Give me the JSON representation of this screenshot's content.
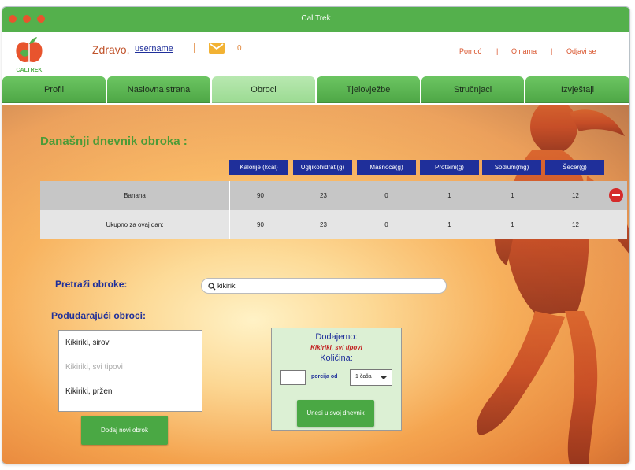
{
  "window": {
    "title": "Cal Trek"
  },
  "header": {
    "logo_text": "CALTREK",
    "greeting": "Zdravo,",
    "username": "username",
    "separator": "|",
    "messages_count": "0",
    "links": [
      "Pomoć",
      "O nama",
      "Odjavi se"
    ],
    "link_separator": "|"
  },
  "tabs": [
    {
      "label": "Profil",
      "active": false
    },
    {
      "label": "Naslovna strana",
      "active": false
    },
    {
      "label": "Obroci",
      "active": true
    },
    {
      "label": "Tjelovježbe",
      "active": false
    },
    {
      "label": "Stručnjaci",
      "active": false
    },
    {
      "label": "Izvještaji",
      "active": false
    }
  ],
  "diary": {
    "title": "Današnji dnevnik obroka :",
    "columns": [
      "Kalorije (kcal)",
      "Ugljikohidrati(g)",
      "Masnoća(g)",
      "Proteini(g)",
      "Sodium(mg)",
      "Šećer(g)"
    ],
    "rows": [
      {
        "name": "Banana",
        "values": [
          "90",
          "23",
          "0",
          "1",
          "1",
          "12"
        ]
      },
      {
        "name": "Ukupno za ovaj dan:",
        "values": [
          "90",
          "23",
          "0",
          "1",
          "1",
          "12"
        ]
      }
    ]
  },
  "search": {
    "label": "Pretraži obroke:",
    "value": "kikiriki"
  },
  "matches": {
    "label": "Podudarajući obroci:",
    "items": [
      "Kikiriki, sirov",
      "Kikiriki, svi tipovi",
      "Kikiriki, pržen"
    ],
    "selected_index": 1
  },
  "add_new_button": "Dodaj novi obrok",
  "add_panel": {
    "title": "Dodajemo:",
    "food": "Kikiriki, svi tipovi",
    "quantity_label": "Količina:",
    "quantity_value": "",
    "portion_label": "porcija od",
    "unit": "1 čaša",
    "submit": "Unesi u svoj dnevnik"
  },
  "colors": {
    "green": "#54b04c",
    "navy": "#1f2f9a",
    "orange": "#d9532b",
    "red": "#d52a2a"
  }
}
